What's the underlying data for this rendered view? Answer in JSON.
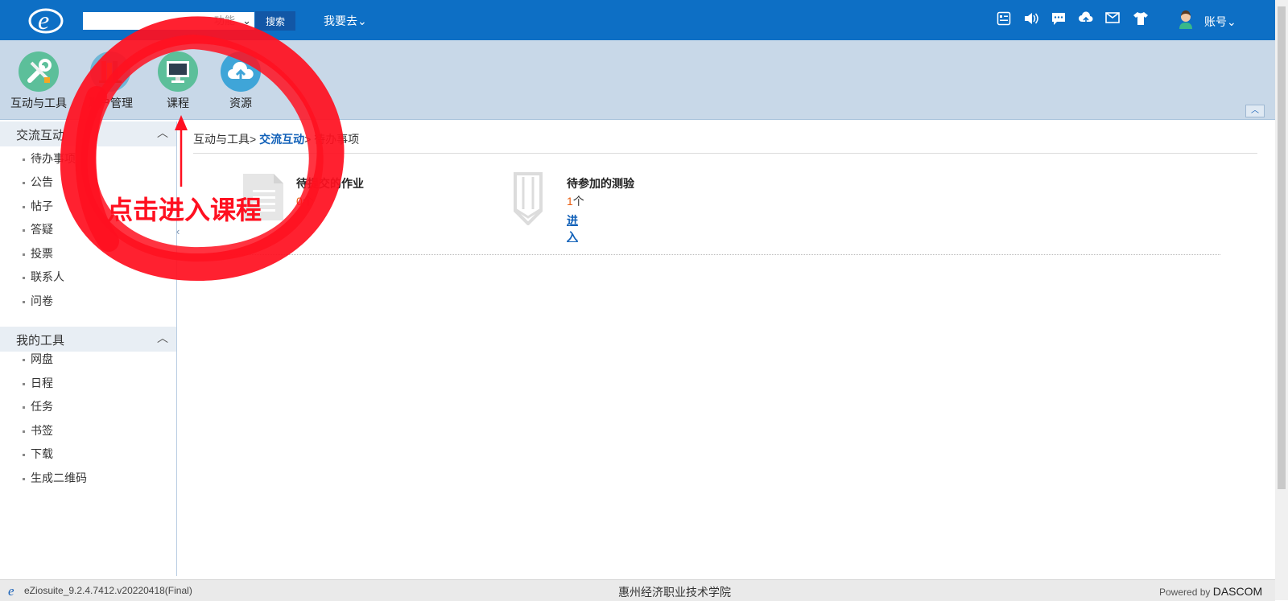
{
  "header": {
    "search_placeholder": "",
    "search_scope": "功能",
    "search_button": "搜索",
    "goto_menu": "我要去",
    "toolbar_icons": [
      "profile-card-icon",
      "speaker-icon",
      "chat-icon",
      "cloud-upload-icon",
      "mail-icon",
      "tshirt-icon"
    ],
    "account_label": "账号"
  },
  "apps": [
    {
      "label": "互动与工具",
      "icon": "tools-icon",
      "color": "#5cbf9a"
    },
    {
      "label": "账户管理",
      "icon": "books-icon",
      "color": "#6fb6d6"
    },
    {
      "label": "课程",
      "icon": "monitor-icon",
      "color": "#5cbf9a"
    },
    {
      "label": "资源",
      "icon": "cloud-icon",
      "color": "#3fa5d8"
    }
  ],
  "sidebar": {
    "sections": [
      {
        "title": "交流互动",
        "items": [
          "待办事项",
          "公告",
          "帖子",
          "答疑",
          "投票",
          "联系人",
          "问卷"
        ]
      },
      {
        "title": "我的工具",
        "items": [
          "网盘",
          "日程",
          "任务",
          "书签",
          "下载",
          "生成二维码"
        ]
      }
    ]
  },
  "breadcrumb": {
    "root": "互动与工具> ",
    "active": "交流互动",
    "current": "> 待办事项"
  },
  "cards": [
    {
      "title": "待提交的作业",
      "count": "0",
      "unit": "个",
      "icon": "document-icon"
    },
    {
      "title": "待参加的测验",
      "count": "1",
      "unit": "个",
      "link": "进入",
      "icon": "pencil-icon"
    }
  ],
  "annotation": {
    "text": "点击进入课程",
    "color": "#ff1020"
  },
  "footer": {
    "version": "eZiosuite_9.2.4.7412.v20220418(Final)",
    "school": "惠州经济职业技术学院",
    "powered_prefix": "Powered by ",
    "powered_brand": "DASCOM"
  }
}
